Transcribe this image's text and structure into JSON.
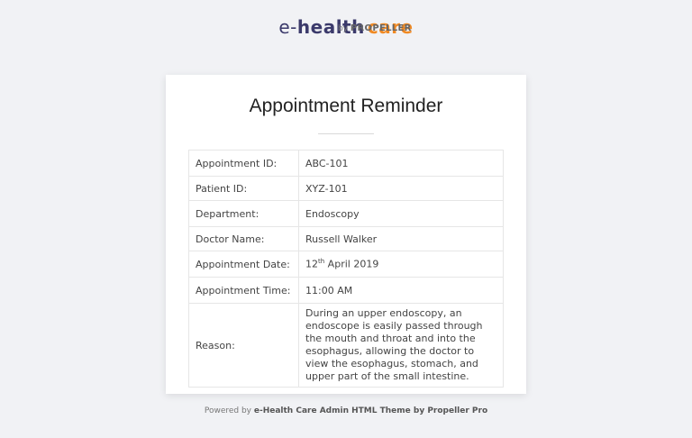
{
  "logo": {
    "part1": "e-",
    "part2": "health",
    "part3": "care",
    "by": "by",
    "brand": "PROPELLER"
  },
  "card": {
    "title": "Appointment Reminder"
  },
  "details": [
    {
      "label": "Appointment ID:",
      "value": "ABC-101"
    },
    {
      "label": "Patient ID:",
      "value": "XYZ-101"
    },
    {
      "label": "Department:",
      "value": "Endoscopy"
    },
    {
      "label": "Doctor Name:",
      "value": "Russell Walker"
    },
    {
      "label": "Appointment Date:",
      "value_day": "12",
      "value_suffix": "th",
      "value_rest": " April 2019"
    },
    {
      "label": "Appointment Time:",
      "value": "11:00 AM"
    },
    {
      "label": "Reason:",
      "value": "During an upper endoscopy, an endoscope is easily passed through the mouth and throat and into the esophagus, allowing the doctor to view the esophagus, stomach, and upper part of the small intestine."
    }
  ],
  "footer": {
    "prefix": "Powered by ",
    "strong": "e-Health Care Admin HTML Theme by Propeller Pro"
  },
  "colors": {
    "background": "#f1f2f5",
    "brand_dark": "#3b3a6b",
    "brand_orange": "#f08a24"
  }
}
